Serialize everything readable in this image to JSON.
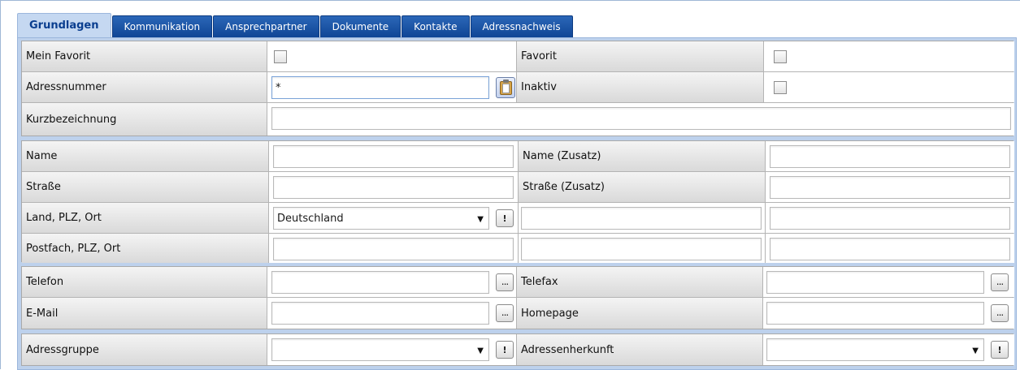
{
  "tabs": [
    {
      "label": "Grundlagen",
      "active": true
    },
    {
      "label": "Kommunikation"
    },
    {
      "label": "Ansprechpartner"
    },
    {
      "label": "Dokumente"
    },
    {
      "label": "Kontakte"
    },
    {
      "label": "Adressnachweis"
    }
  ],
  "section1": {
    "mein_favorit_label": "Mein Favorit",
    "favorit_label": "Favorit",
    "adressnummer_label": "Adressnummer",
    "adressnummer_value": "*",
    "inaktiv_label": "Inaktiv",
    "kurzbezeichnung_label": "Kurzbezeichnung",
    "kurzbezeichnung_value": ""
  },
  "section2": {
    "name_label": "Name",
    "name_value": "",
    "name_zusatz_label": "Name (Zusatz)",
    "name_zusatz_value": "",
    "strasse_label": "Straße",
    "strasse_value": "",
    "strasse_zusatz_label": "Straße (Zusatz)",
    "strasse_zusatz_value": "",
    "land_plz_ort_label": "Land, PLZ, Ort",
    "land_value": "Deutschland",
    "postfach_label": "Postfach, PLZ, Ort"
  },
  "section3": {
    "telefon_label": "Telefon",
    "telefax_label": "Telefax",
    "email_label": "E-Mail",
    "homepage_label": "Homepage",
    "dots": "..."
  },
  "section4": {
    "adressgruppe_label": "Adressgruppe",
    "adressgruppe_value": "",
    "adressenherkunft_label": "Adressenherkunft",
    "adressenherkunft_value": "",
    "alert": "!"
  },
  "icons": {
    "clipboard": "clipboard-icon",
    "ellipsis": "ellipsis-icon",
    "exclamation": "exclamation-icon",
    "dropdown": "dropdown-arrow-icon"
  },
  "colors": {
    "tab_active_bg": "#c5d8f1",
    "tab_bg": "#1452a3",
    "panel_bg": "#bdd1ec"
  }
}
